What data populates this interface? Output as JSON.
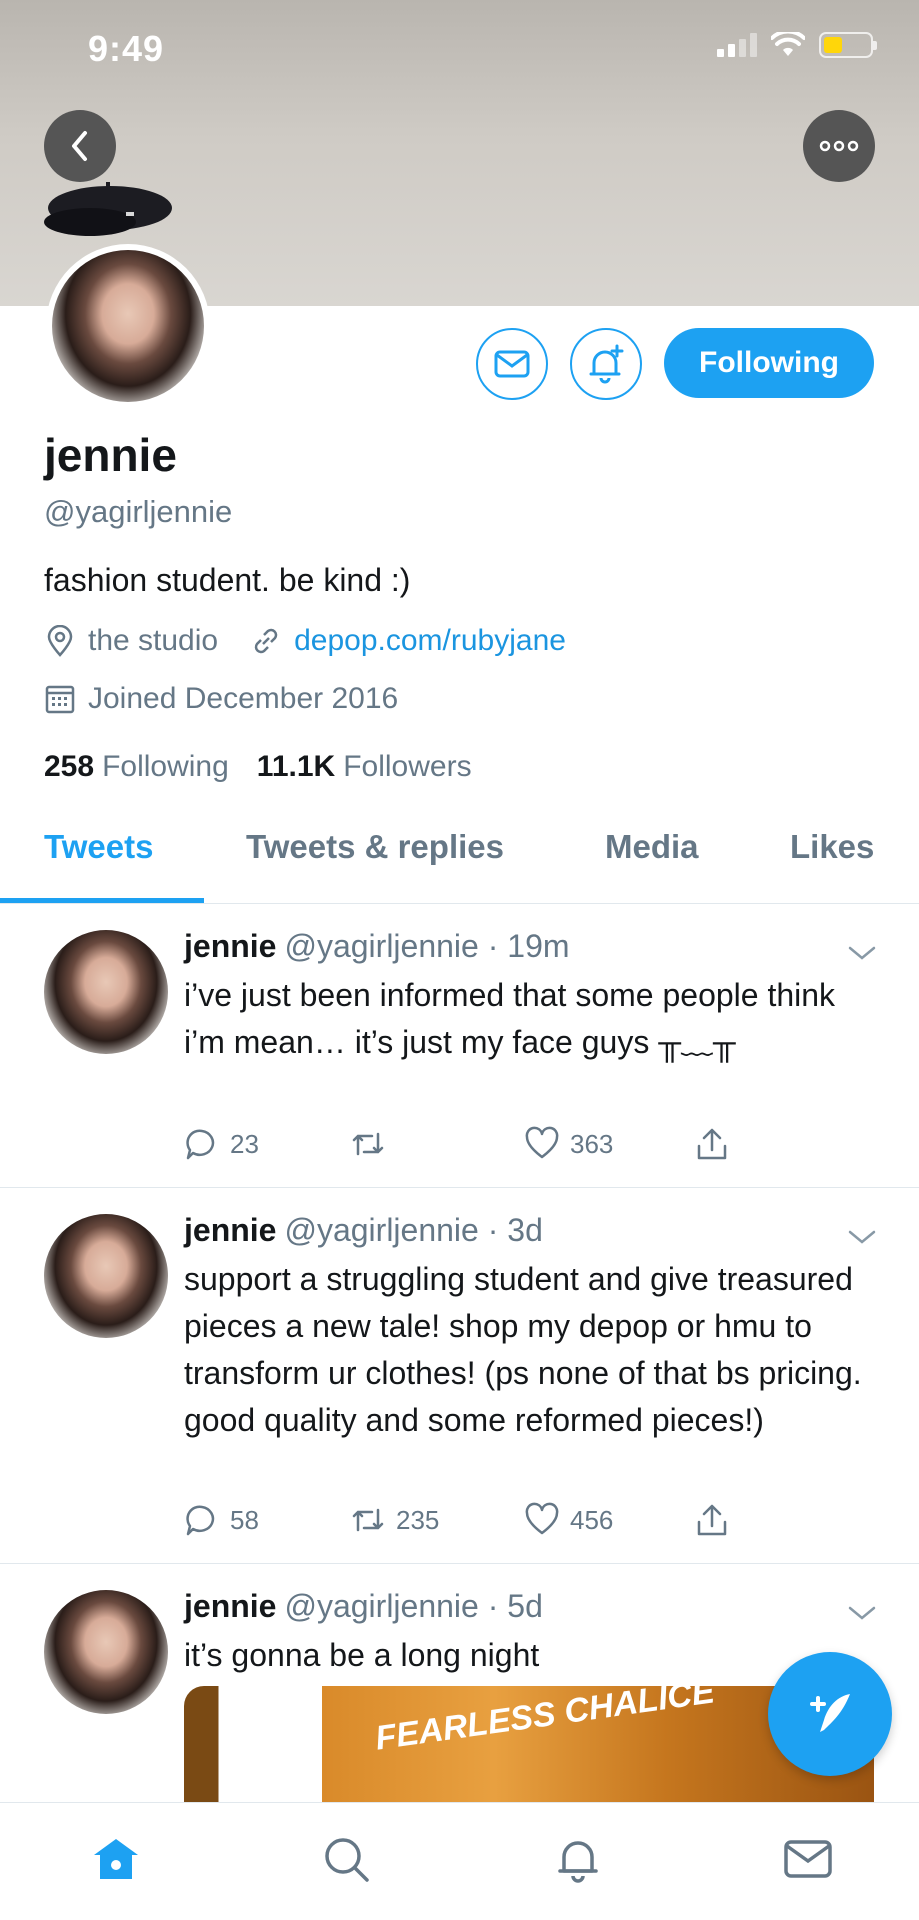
{
  "status_bar": {
    "time": "9:49"
  },
  "colors": {
    "accent": "#1da1f2",
    "text": "#14171a",
    "muted": "#657786",
    "link": "#1b95e0",
    "battery": "#ffd60a"
  },
  "header": {
    "back_icon": "chevron-left-icon",
    "more_icon": "more-dots-icon"
  },
  "profile": {
    "name": "jennie",
    "handle": "@yagirljennie",
    "bio": "fashion student. be kind :)",
    "location": "the studio",
    "website": "depop.com/rubyjane",
    "joined": "Joined December 2016",
    "following_count": "258",
    "following_label": "Following",
    "followers_count": "11.1K",
    "followers_label": "Followers",
    "follow_button": "Following"
  },
  "tabs": [
    {
      "label": "Tweets",
      "active": true
    },
    {
      "label": "Tweets & replies",
      "active": false
    },
    {
      "label": "Media",
      "active": false
    },
    {
      "label": "Likes",
      "active": false
    }
  ],
  "tweets": [
    {
      "name": "jennie",
      "handle": "@yagirljennie",
      "sep": "·",
      "time": "19m",
      "text": "i’ve just been informed that some people think i’m mean… it’s just my face guys ╥﹏╥",
      "replies": "23",
      "retweets": "",
      "likes": "363"
    },
    {
      "name": "jennie",
      "handle": "@yagirljennie",
      "sep": "·",
      "time": "3d",
      "text": "support a struggling student and give treasured pieces a new tale! shop my depop or hmu to transform ur clothes! (ps none of that bs pricing. good quality and some reformed pieces!)",
      "replies": "58",
      "retweets": "235",
      "likes": "456"
    },
    {
      "name": "jennie",
      "handle": "@yagirljennie",
      "sep": "·",
      "time": "5d",
      "text": "it’s gonna be a long night",
      "media_text": "FEARLESS CHALICE"
    }
  ],
  "nav": [
    "home-icon",
    "search-icon",
    "bell-icon",
    "mail-icon"
  ]
}
